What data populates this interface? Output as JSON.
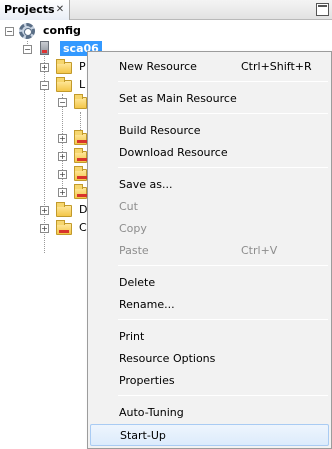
{
  "panel": {
    "tab_label": "Projects",
    "close_glyph": "✕"
  },
  "tree": {
    "root_label": "config",
    "device_label": "sca06",
    "partial_labels": [
      "P",
      "L",
      "D",
      "C"
    ]
  },
  "context_menu": {
    "groups": [
      [
        {
          "label": "New Resource",
          "shortcut": "Ctrl+Shift+R",
          "enabled": true
        }
      ],
      [
        {
          "label": "Set as Main Resource",
          "shortcut": "",
          "enabled": true
        }
      ],
      [
        {
          "label": "Build Resource",
          "shortcut": "",
          "enabled": true
        },
        {
          "label": "Download Resource",
          "shortcut": "",
          "enabled": true
        }
      ],
      [
        {
          "label": "Save as...",
          "shortcut": "",
          "enabled": true
        },
        {
          "label": "Cut",
          "shortcut": "",
          "enabled": false
        },
        {
          "label": "Copy",
          "shortcut": "",
          "enabled": false
        },
        {
          "label": "Paste",
          "shortcut": "Ctrl+V",
          "enabled": false
        }
      ],
      [
        {
          "label": "Delete",
          "shortcut": "",
          "enabled": true
        },
        {
          "label": "Rename...",
          "shortcut": "",
          "enabled": true
        }
      ],
      [
        {
          "label": "Print",
          "shortcut": "",
          "enabled": true
        },
        {
          "label": "Resource Options",
          "shortcut": "",
          "enabled": true
        },
        {
          "label": "Properties",
          "shortcut": "",
          "enabled": true
        }
      ],
      [
        {
          "label": "Auto-Tuning",
          "shortcut": "",
          "enabled": true
        },
        {
          "label": "Start-Up",
          "shortcut": "",
          "enabled": true,
          "highlighted": true
        }
      ]
    ]
  },
  "colors": {
    "selection": "#3399ff",
    "menu_background": "#f2f2f2",
    "disabled_text": "#8d8d8d",
    "hover_highlight": "#dcebfc"
  }
}
